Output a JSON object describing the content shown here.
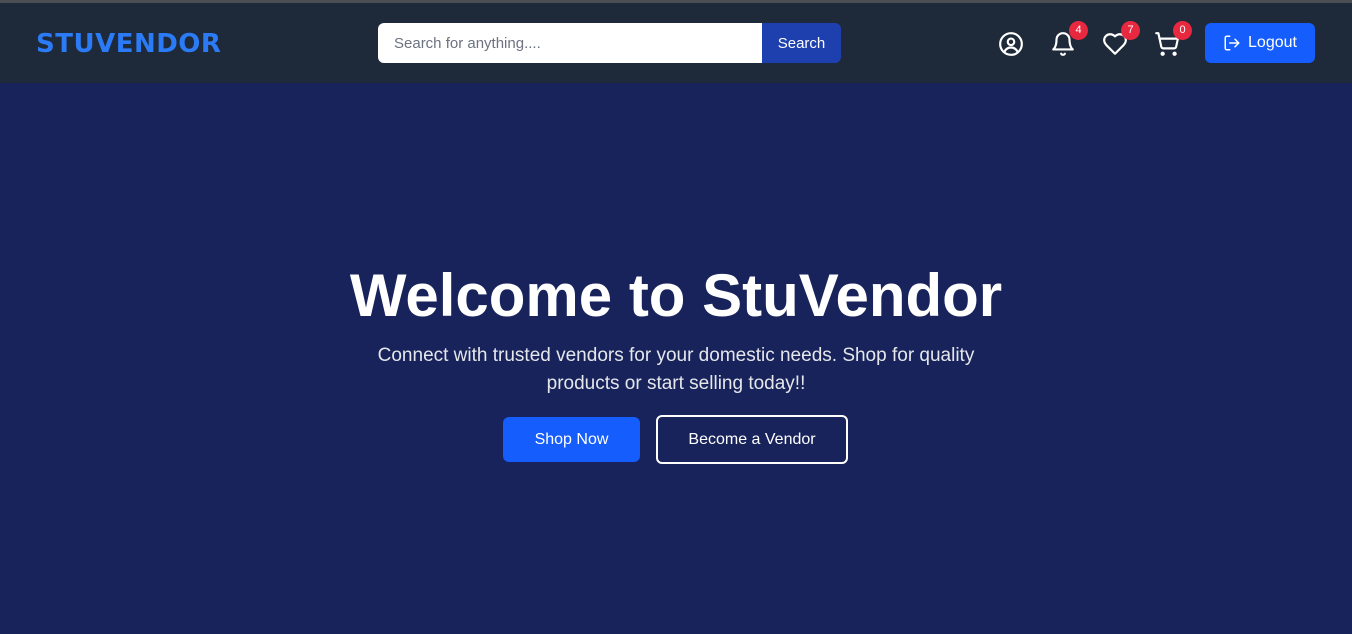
{
  "header": {
    "brand": "STUVENDOR",
    "search": {
      "placeholder": "Search for anything....",
      "value": "",
      "button_label": "Search"
    },
    "icons": [
      {
        "name": "user-icon"
      },
      {
        "name": "bell-icon",
        "badge": "4"
      },
      {
        "name": "heart-icon",
        "badge": "7"
      },
      {
        "name": "cart-icon",
        "badge": "0"
      }
    ],
    "logout_label": "Logout"
  },
  "hero": {
    "title": "Welcome to StuVendor",
    "subtitle": "Connect with trusted vendors for your domestic needs. Shop for quality products or start selling today!!",
    "shop_label": "Shop Now",
    "vendor_label": "Become a Vendor"
  },
  "colors": {
    "navbar": "#1e2939",
    "hero_bg": "#17235a",
    "brand": "#2b7bf6",
    "primary_button": "#155dfc",
    "search_button": "#1e3fae",
    "badge": "#e7283f"
  }
}
